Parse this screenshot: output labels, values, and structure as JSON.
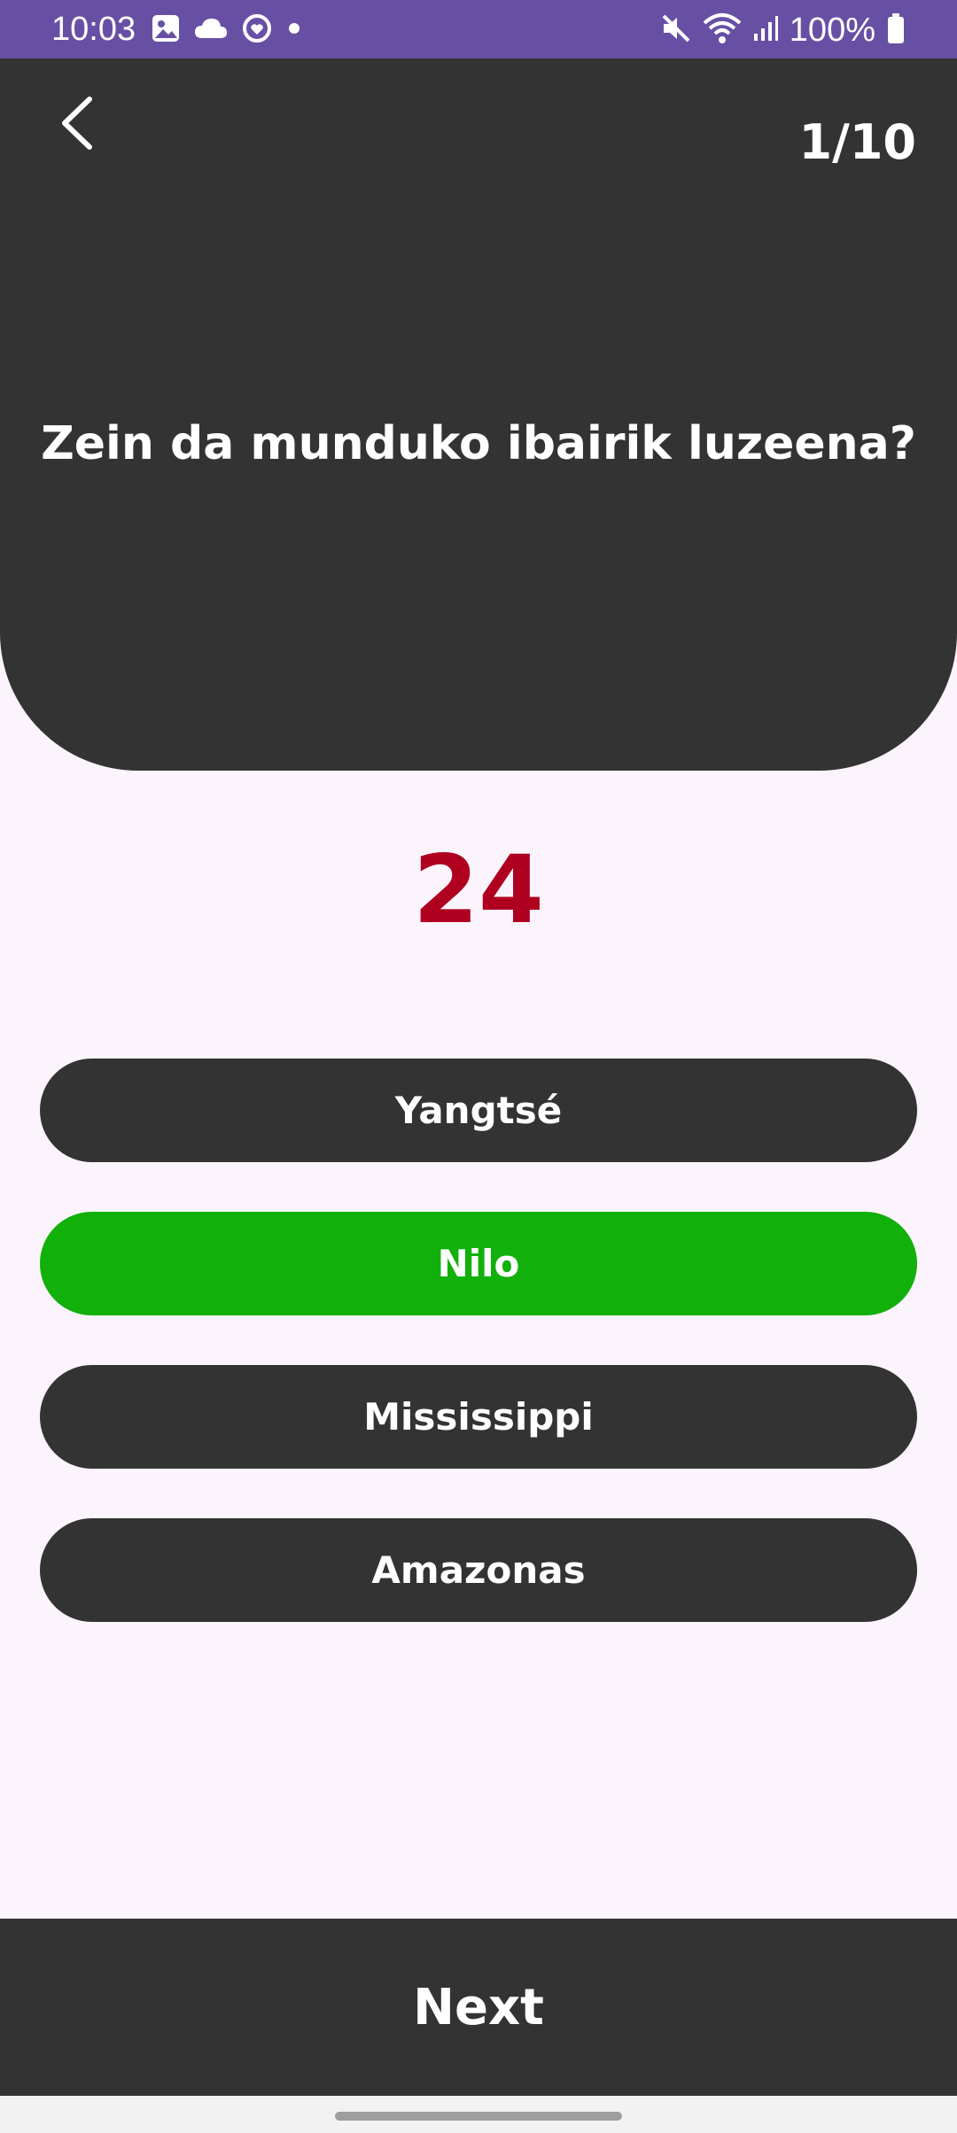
{
  "status_bar": {
    "time": "10:03",
    "battery": "100%",
    "icons_left": [
      "gallery-icon",
      "cloud-icon",
      "heart-sync-icon",
      "dot-icon"
    ],
    "icons_right": [
      "mute-icon",
      "wifi-icon",
      "signal-icon",
      "battery-icon"
    ]
  },
  "header": {
    "counter": "1/10",
    "question": "Zein da munduko ibairik luzeena?"
  },
  "timer": "24",
  "answers": [
    {
      "label": "Yangtsé",
      "state": "default"
    },
    {
      "label": "Nilo",
      "state": "correct"
    },
    {
      "label": "Mississippi",
      "state": "default"
    },
    {
      "label": "Amazonas",
      "state": "default"
    }
  ],
  "footer": {
    "next_label": "Next"
  },
  "colors": {
    "status_bar": "#6750a4",
    "card": "#333333",
    "background": "#fcf4fc",
    "timer": "#b00020",
    "correct": "#11b00b"
  }
}
